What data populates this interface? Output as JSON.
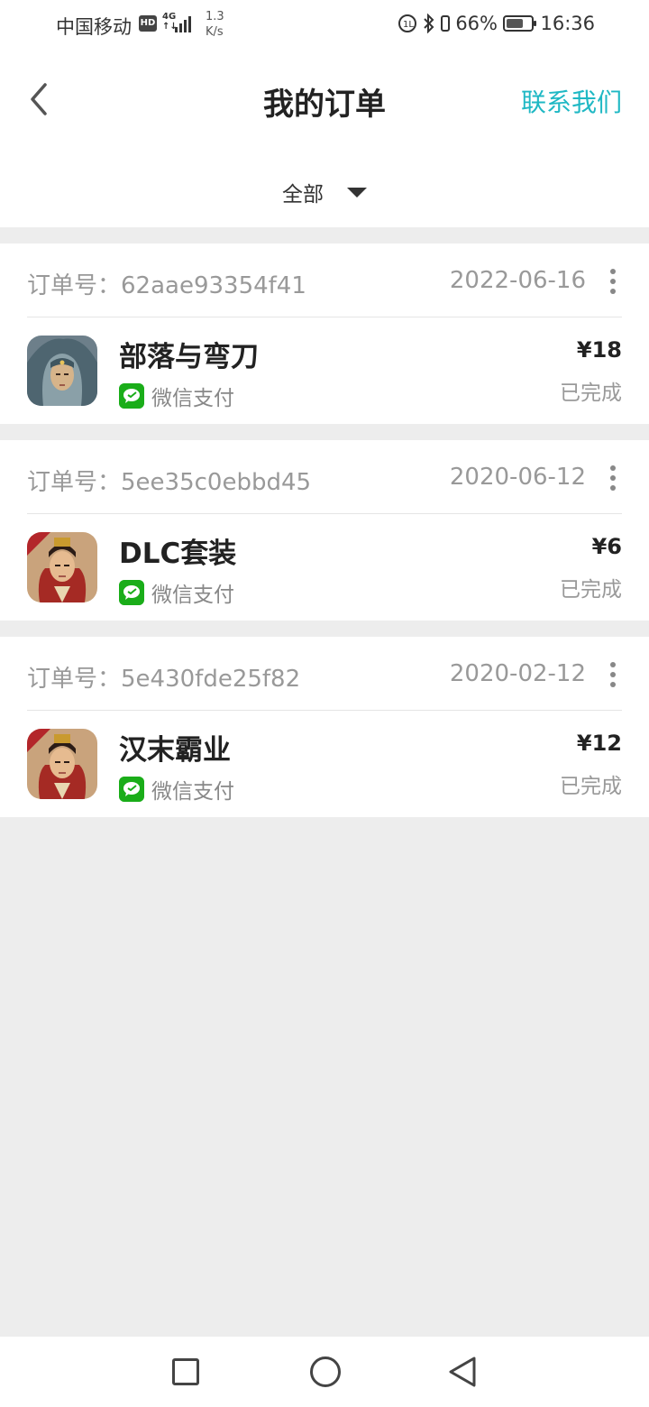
{
  "status_bar": {
    "carrier": "中国移动",
    "hd": "HD",
    "network_line1": "4G",
    "network_line2": "↑↓",
    "speed_value": "1.3",
    "speed_unit": "K/s",
    "battery_percent": "66%",
    "time": "16:36"
  },
  "header": {
    "title": "我的订单",
    "contact": "联系我们",
    "filter_label": "全部"
  },
  "colors": {
    "accent": "#1fb8c4",
    "wechat_green": "#1aad19",
    "background": "#ededed"
  },
  "orders": [
    {
      "order_label": "订单号：62aae93354f41",
      "date": "2022-06-16",
      "name": "部落与弯刀",
      "payment": "微信支付",
      "price": "¥18",
      "status": "已完成",
      "icon": "game-icon-tribe"
    },
    {
      "order_label": "订单号：5ee35c0ebbd45",
      "date": "2020-06-12",
      "name": "DLC套装",
      "payment": "微信支付",
      "price": "¥6",
      "status": "已完成",
      "icon": "game-icon-han"
    },
    {
      "order_label": "订单号：5e430fde25f82",
      "date": "2020-02-12",
      "name": "汉末霸业",
      "payment": "微信支付",
      "price": "¥12",
      "status": "已完成",
      "icon": "game-icon-han"
    }
  ]
}
